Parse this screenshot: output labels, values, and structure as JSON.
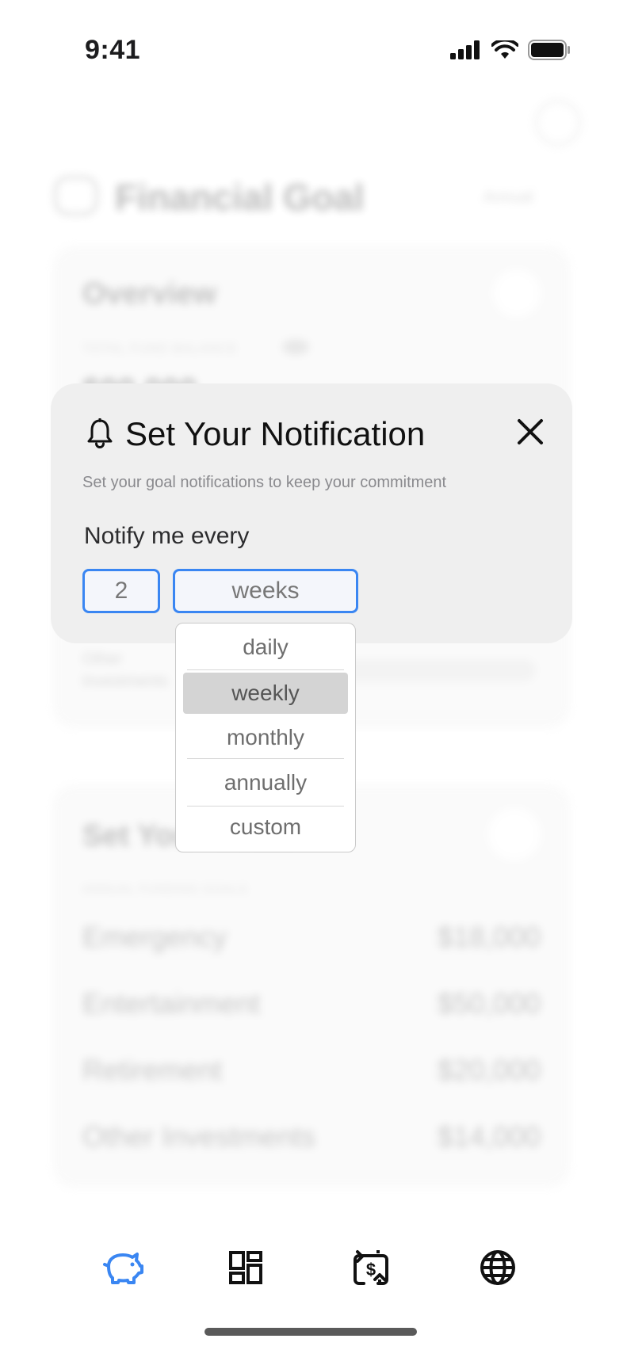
{
  "status_bar": {
    "time": "9:41"
  },
  "background": {
    "header_title": "Financial Goal",
    "header_toggle": "Annual",
    "overview": {
      "title": "Overview",
      "caption": "TOTAL FUND BALANCE",
      "amount": "$00,000",
      "row_label": "Other Investments"
    },
    "goals": {
      "title": "Set Your Goals",
      "caption": "ANNUAL FUNDING GOALS",
      "rows": [
        {
          "label": "Emergency",
          "value": "$18,000"
        },
        {
          "label": "Entertainment",
          "value": "$50,000"
        },
        {
          "label": "Retirement",
          "value": "$20,000"
        },
        {
          "label": "Other Investments",
          "value": "$14,000"
        }
      ]
    }
  },
  "modal": {
    "title": "Set Your Notification",
    "subtitle": "Set your goal notifications to keep your commitment",
    "notify_label": "Notify me every",
    "interval_value": "2",
    "unit_value": "weeks",
    "dropdown_options": [
      "daily",
      "weekly",
      "monthly",
      "annually",
      "custom"
    ],
    "selected_option": "weekly"
  },
  "tabbar": {
    "tabs": [
      "piggy-bank-icon",
      "dashboard-grid-icon",
      "money-exchange-icon",
      "globe-icon"
    ],
    "active_color": "#3a86f2"
  },
  "colors": {
    "accent": "#3a86f2",
    "modal_bg": "#efefef"
  }
}
